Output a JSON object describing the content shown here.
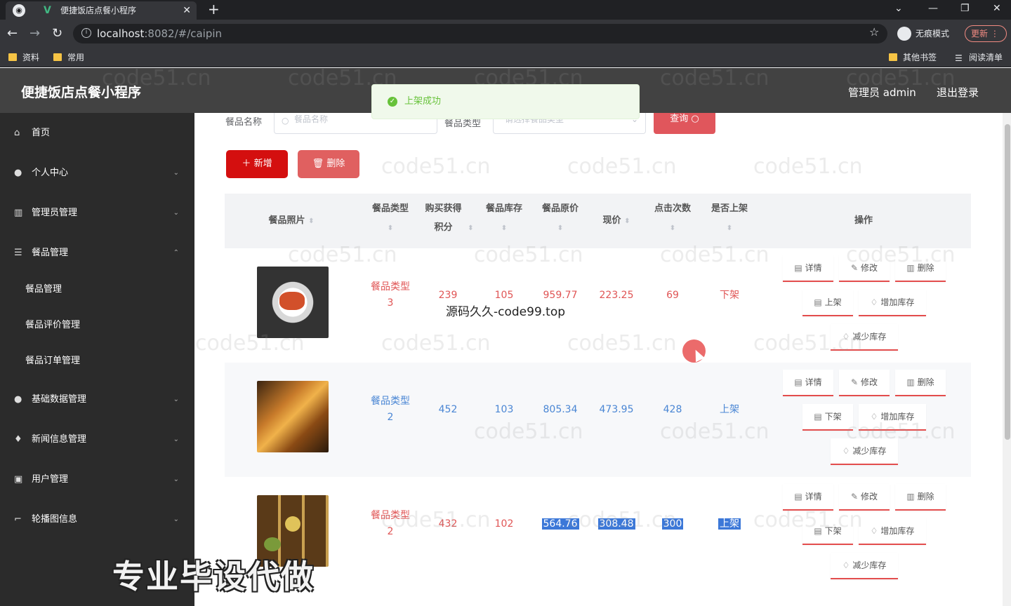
{
  "browser": {
    "tab_title": "便捷饭店点餐小程序",
    "tab_close": "✕",
    "new_tab": "+",
    "url_host": "localhost",
    "url_path": ":8082/#/caipin",
    "incognito_label": "无痕模式",
    "update_label": "更新",
    "bookmarks": [
      "资料",
      "常用"
    ],
    "other_bookmarks": "其他书签",
    "reading_list": "阅读清单"
  },
  "app": {
    "title": "便捷饭店点餐小程序",
    "admin_label": "管理员 admin",
    "logout_label": "退出登录"
  },
  "sidebar": {
    "items": [
      {
        "label": "首页",
        "icon": "home-icon"
      },
      {
        "label": "个人中心",
        "icon": "user-icon"
      },
      {
        "label": "管理员管理",
        "icon": "bars-icon"
      },
      {
        "label": "餐品管理",
        "icon": "menu-icon"
      },
      {
        "label": "餐品管理",
        "icon": "",
        "sub": true
      },
      {
        "label": "餐品评价管理",
        "icon": "",
        "sub": true
      },
      {
        "label": "餐品订单管理",
        "icon": "",
        "sub": true
      },
      {
        "label": "基础数据管理",
        "icon": "user-icon"
      },
      {
        "label": "新闻信息管理",
        "icon": "bulb-icon"
      },
      {
        "label": "用户管理",
        "icon": "calendar-icon"
      },
      {
        "label": "轮播图信息",
        "icon": "crop-icon"
      }
    ]
  },
  "search": {
    "name_label": "餐品名称",
    "name_placeholder": "餐品名称",
    "type_label": "餐品类型",
    "type_placeholder": "请选择餐品类型",
    "query_label": "查询"
  },
  "toolbar": {
    "add_label": "新增",
    "delete_label": "删除"
  },
  "table": {
    "headers": {
      "photo": "餐品照片",
      "type": "餐品类型",
      "points": "购买获得积分",
      "stock": "餐品库存",
      "original": "餐品原价",
      "price": "现价",
      "clicks": "点击次数",
      "onsale": "是否上架",
      "ops": "操作"
    },
    "rows": [
      {
        "type": "餐品类型3",
        "points": "239",
        "stock": "105",
        "original": "959.77",
        "price": "223.25",
        "clicks": "69",
        "onsale": "下架",
        "toggle": "上架",
        "color": "#e05555"
      },
      {
        "type": "餐品类型2",
        "points": "452",
        "stock": "103",
        "original": "805.34",
        "price": "473.95",
        "clicks": "428",
        "onsale": "上架",
        "toggle": "下架",
        "color": "#4a86d4"
      },
      {
        "type": "餐品类型2",
        "points": "432",
        "stock": "102",
        "original": "564.76",
        "price": "308.48",
        "clicks": "300",
        "onsale": "上架",
        "toggle": "下架",
        "color": "#e05555"
      }
    ],
    "ops": {
      "detail": "详情",
      "edit": "修改",
      "delete": "删除",
      "add_stock": "增加库存",
      "reduce_stock": "减少库存"
    }
  },
  "toast": {
    "message": "上架成功"
  },
  "overlay": {
    "source_text": "源码久久-code99.top",
    "banner": "专业毕设代做",
    "watermark": "code51.cn"
  }
}
